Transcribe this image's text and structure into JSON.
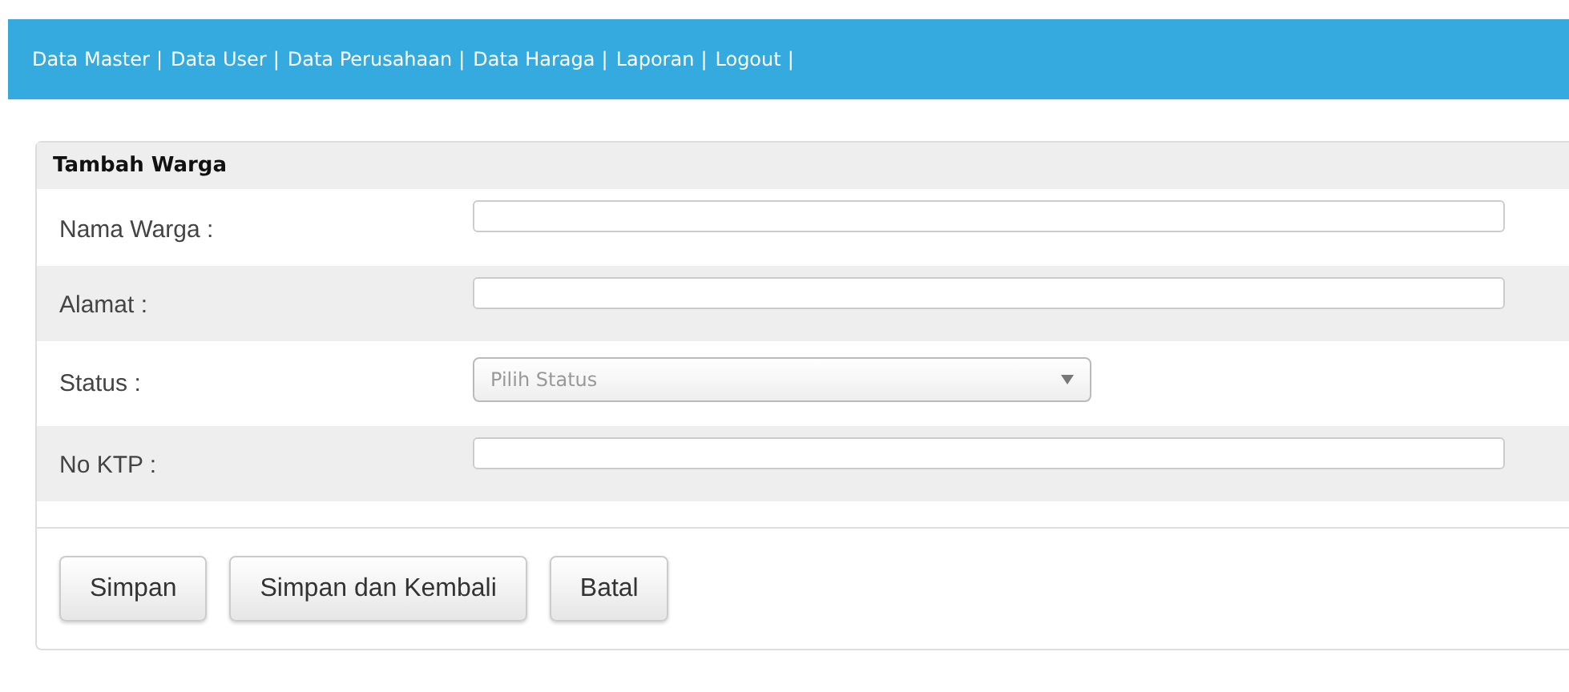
{
  "nav": {
    "separator": "|",
    "items": [
      "Data Master",
      "Data User",
      "Data Perusahaan",
      "Data Haraga",
      "Laporan",
      "Logout"
    ]
  },
  "form": {
    "title": "Tambah Warga",
    "fields": [
      {
        "kind": "text",
        "label": "Nama Warga :"
      },
      {
        "kind": "text",
        "label": "Alamat :"
      },
      {
        "kind": "select",
        "label": "Status :",
        "placeholder": "Pilih Status"
      },
      {
        "kind": "text",
        "label": "No KTP :"
      }
    ],
    "buttons": [
      "Simpan",
      "Simpan dan Kembali",
      "Batal"
    ]
  }
}
